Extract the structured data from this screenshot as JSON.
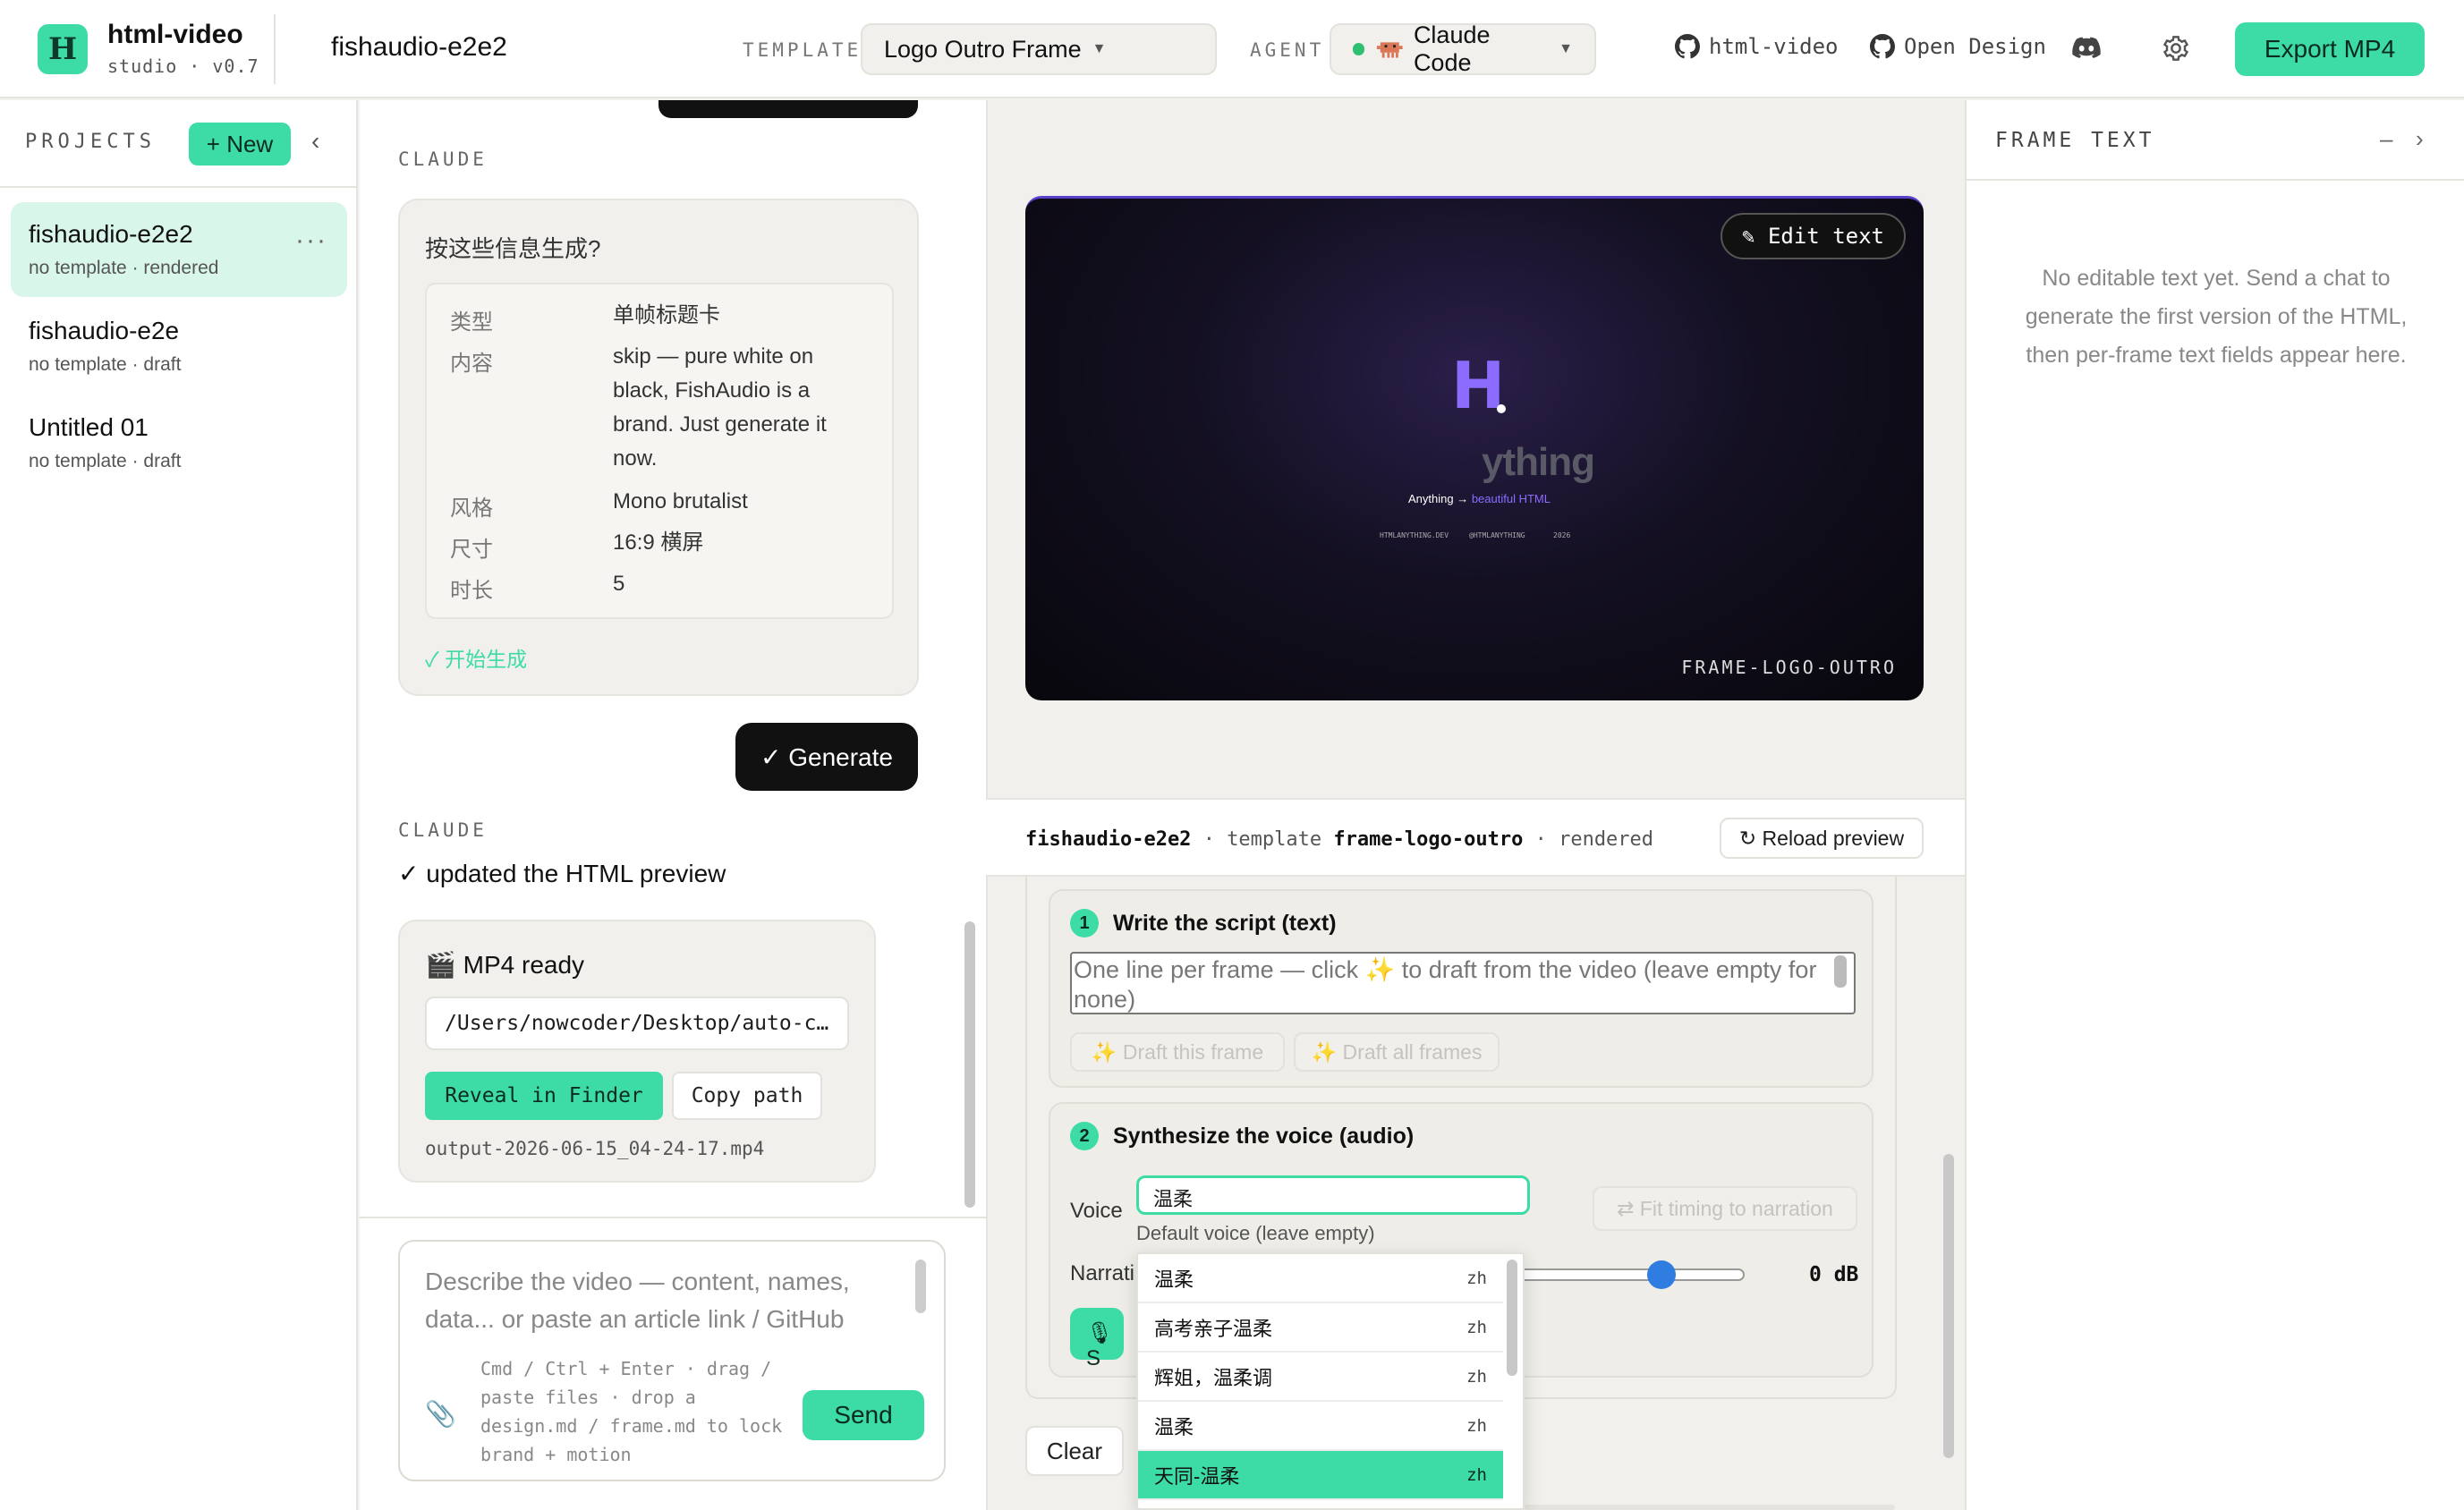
{
  "app": {
    "name": "html-video",
    "version": "studio · v0.7",
    "logo_letter": "H"
  },
  "header": {
    "project_name": "fishaudio-e2e2",
    "template_label": "TEMPLATE",
    "template_value": "Logo Outro Frame",
    "agent_label": "AGENT",
    "agent_value": "Claude Code",
    "links": [
      "html-video",
      "Open Design"
    ],
    "export_label": "Export MP4"
  },
  "sidebar": {
    "heading": "PROJECTS",
    "new_label": "+ New",
    "items": [
      {
        "name": "fishaudio-e2e2",
        "meta": "no template · rendered",
        "active": true
      },
      {
        "name": "fishaudio-e2e",
        "meta": "no template · draft"
      },
      {
        "name": "Untitled 01",
        "meta": "no template · draft"
      }
    ]
  },
  "chat": {
    "claude_label": "CLAUDE",
    "question": "按这些信息生成?",
    "fields": [
      {
        "k": "类型",
        "v": "单帧标题卡"
      },
      {
        "k": "内容",
        "v": "skip — pure white on black, FishAudio is a brand. Just generate it now."
      },
      {
        "k": "风格",
        "v": "Mono brutalist"
      },
      {
        "k": "尺寸",
        "v": "16:9 横屏"
      },
      {
        "k": "时长",
        "v": "5"
      }
    ],
    "start_label": "✓ 开始生成",
    "generate_label": "✓ Generate",
    "updated_msg": "✓ updated the HTML preview",
    "mp4_title": "🎬 MP4 ready",
    "mp4_path": "/Users/nowcoder/Desktop/auto-c…",
    "reveal_label": "Reveal in Finder",
    "copy_label": "Copy path",
    "output_file": "output-2026-06-15_04-24-17.mp4",
    "input_placeholder": "Describe the video — content, names, data... or paste an article link / GitHub",
    "input_hint": "Cmd / Ctrl + Enter · drag / paste files · drop a design.md / frame.md to lock brand + motion",
    "send_label": "Send"
  },
  "preview": {
    "edit_text_label": "✎ Edit text",
    "frame_logo_letter": "H",
    "frame_word": "ything",
    "frame_tagline_a": "Anything →",
    "frame_tagline_b": "beautiful HTML",
    "frame_footer": [
      "HTMLANYTHING.DEV",
      "@HTMLANYTHING",
      "2026"
    ],
    "frame_label": "FRAME-LOGO-OUTRO",
    "status_project": "fishaudio-e2e2",
    "status_template_word": "template",
    "status_template": "frame-logo-outro",
    "status_state": "rendered",
    "reload_label": "↻ Reload preview",
    "step1_num": "1",
    "step1_title": "Write the script (text)",
    "script_placeholder": "One line per frame — click ✨ to draft from the video (leave empty for none)",
    "draft_frame_label": "✨ Draft this frame",
    "draft_all_label": "✨ Draft all frames",
    "step2_num": "2",
    "step2_title": "Synthesize the voice (audio)",
    "voice_label": "Voice",
    "voice_value": "温柔",
    "voice_hint": "Default voice (leave empty)",
    "fit_timing_label": "⇄ Fit timing to narration",
    "narration_label": "Narrati",
    "gain_value": "0 dB",
    "gain_level": 0.63,
    "clear_label": "Clear"
  },
  "voice_dropdown": [
    {
      "name": "温柔",
      "lang": "zh"
    },
    {
      "name": "高考亲子温柔",
      "lang": "zh"
    },
    {
      "name": "辉姐，温柔调",
      "lang": "zh"
    },
    {
      "name": "温柔",
      "lang": "zh"
    },
    {
      "name": "天同-温柔",
      "lang": "zh",
      "selected": true
    }
  ],
  "right_panel": {
    "title": "FRAME TEXT",
    "empty_msg": "No editable text yet. Send a chat to generate the first version of the HTML, then per-frame text fields appear here."
  },
  "colors": {
    "accent": "#3ddca6",
    "dark": "#111111",
    "purple": "#7a5cf0"
  }
}
